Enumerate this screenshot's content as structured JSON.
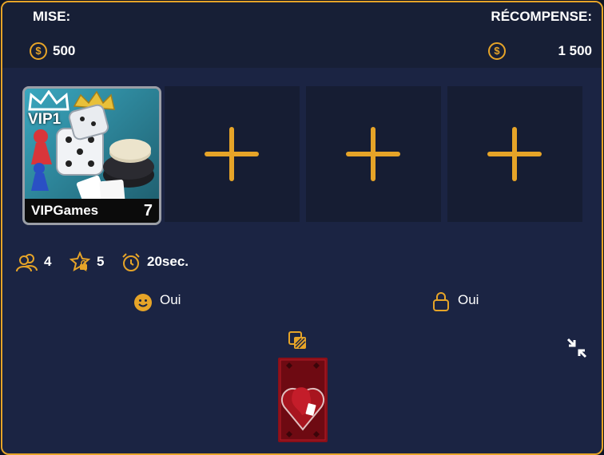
{
  "header": {
    "bet_label": "MISE:",
    "reward_label": "RÉCOMPENSE:",
    "coin_symbol": "$",
    "bet_value": "500",
    "reward_value": "1 500"
  },
  "game": {
    "name": "VIPGames",
    "badge": "VIP1",
    "count": "7"
  },
  "stats": {
    "players": "4",
    "level": "5",
    "timer": "20sec."
  },
  "options": {
    "emoji_value": "Oui",
    "private_value": "Oui"
  },
  "colors": {
    "accent": "#e6a428",
    "background": "#1b2443",
    "header": "#171f36",
    "slot": "#161d33"
  },
  "icons": [
    "coin-icon",
    "players-icon",
    "star-lock-icon",
    "alarm-clock-icon",
    "smiley-icon",
    "lock-icon",
    "card-back-switch-icon",
    "collapse-icon",
    "add-slot-icon"
  ]
}
